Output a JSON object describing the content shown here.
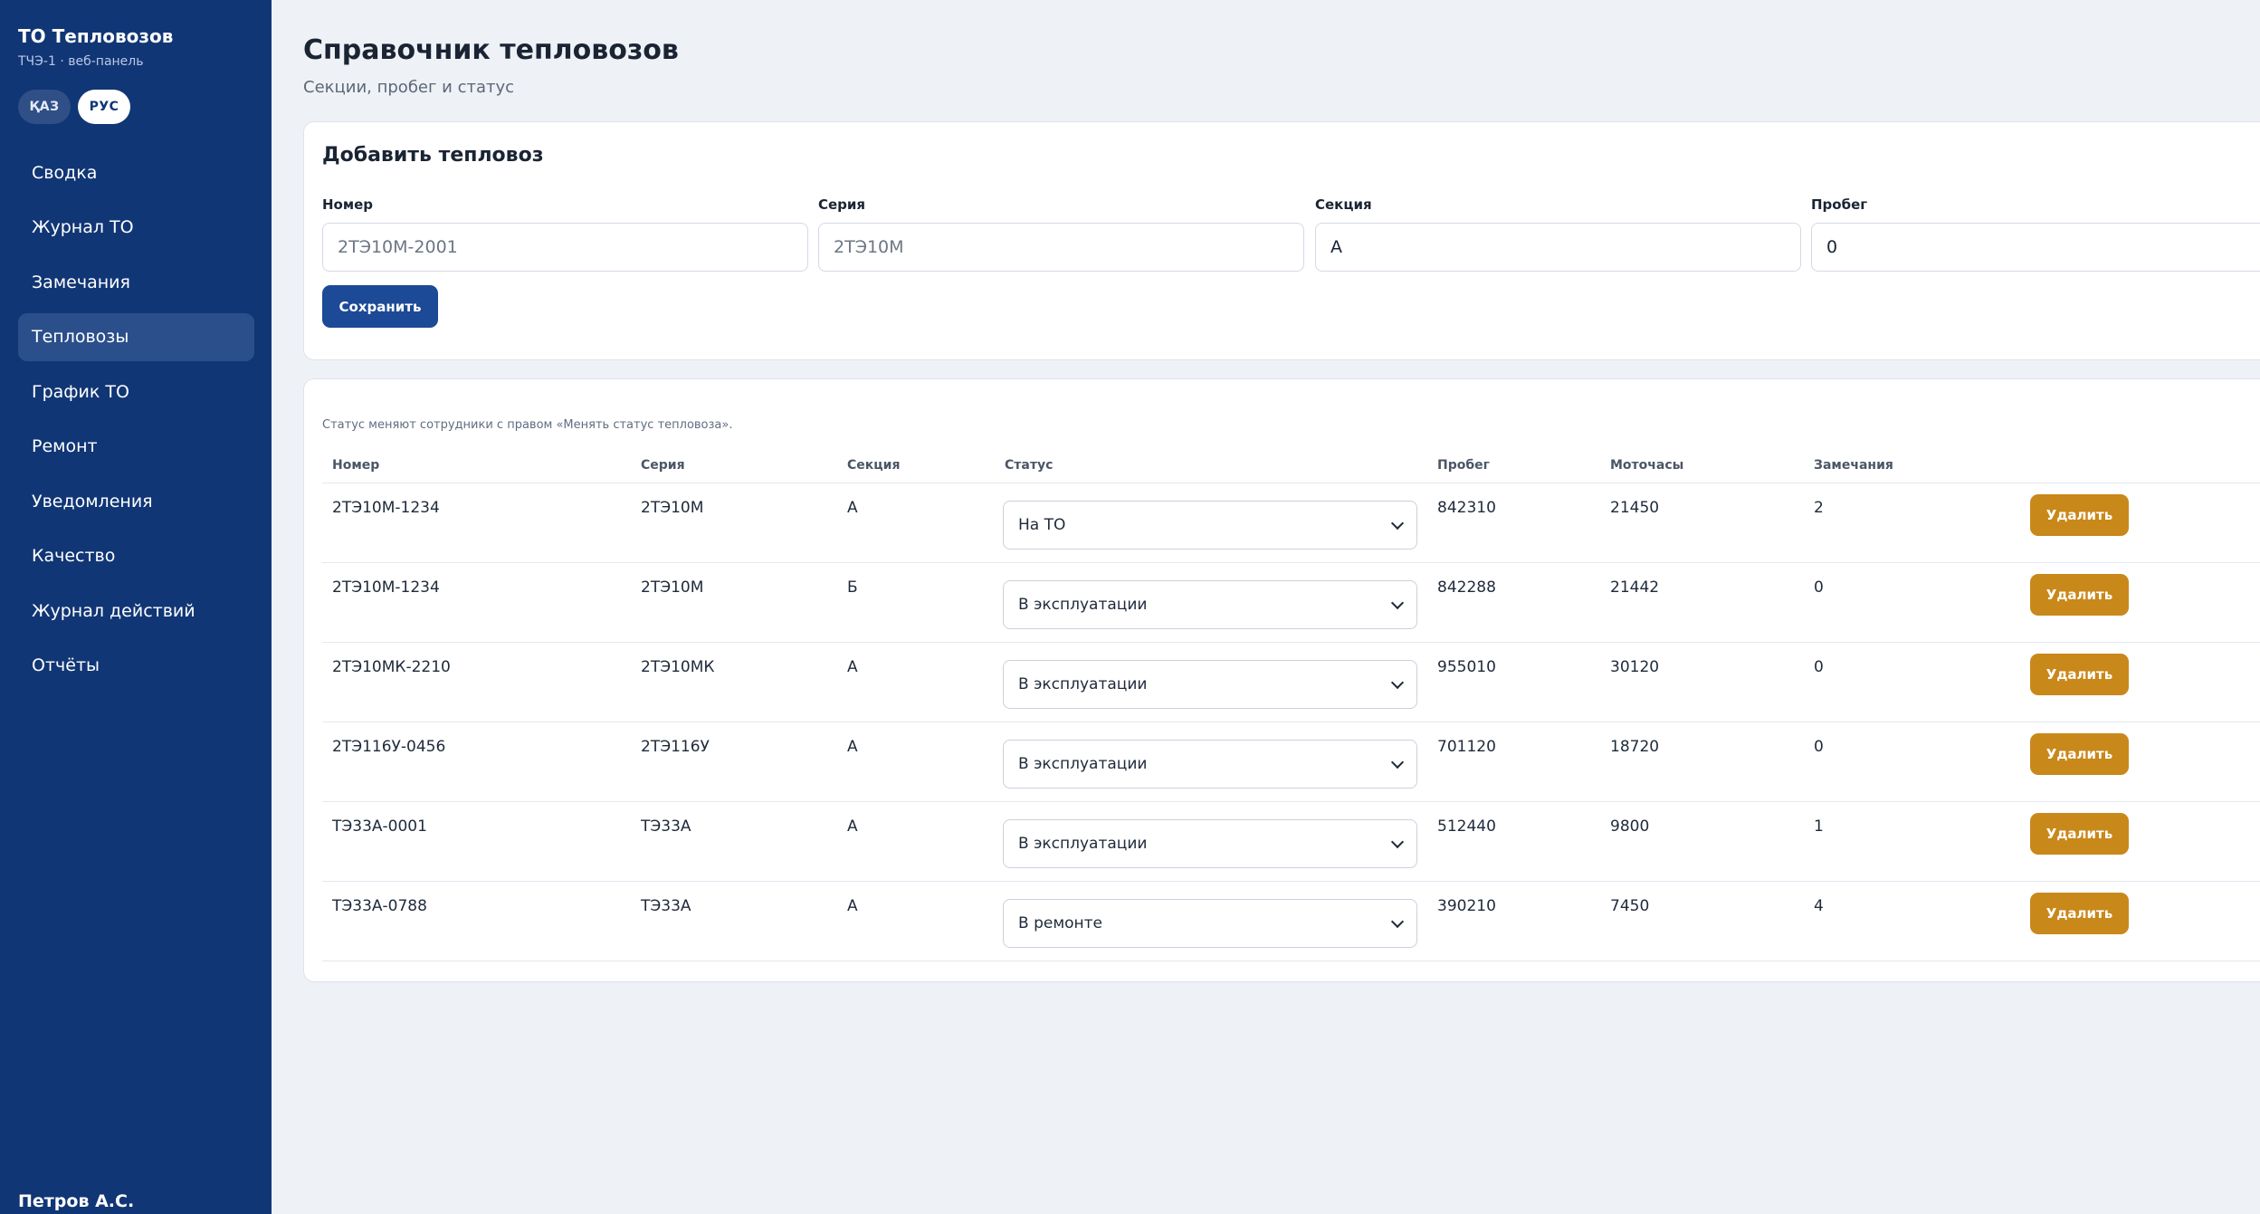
{
  "sidebar": {
    "brand_title": "ТО Тепловозов",
    "brand_sub": "ТЧЭ-1 · веб-панель",
    "lang": {
      "kaz": "ҚАЗ",
      "rus": "РУС",
      "selected": "РУС"
    },
    "items": [
      {
        "label": "Сводка"
      },
      {
        "label": "Журнал ТО"
      },
      {
        "label": "Замечания"
      },
      {
        "label": "Тепловозы",
        "active": true
      },
      {
        "label": "График ТО"
      },
      {
        "label": "Ремонт"
      },
      {
        "label": "Уведомления"
      },
      {
        "label": "Качество"
      },
      {
        "label": "Журнал действий"
      },
      {
        "label": "Отчёты"
      }
    ],
    "user_name": "Петров А.С."
  },
  "header": {
    "title": "Справочник тепловозов",
    "subtitle": "Секции, пробег и статус"
  },
  "add_form": {
    "title": "Добавить тепловоз",
    "fields": {
      "number": {
        "label": "Номер",
        "value": "",
        "placeholder": "2ТЭ10М-2001"
      },
      "series": {
        "label": "Серия",
        "value": "",
        "placeholder": "2ТЭ10М"
      },
      "section": {
        "label": "Секция",
        "value": "А",
        "placeholder": ""
      },
      "mileage": {
        "label": "Пробег",
        "value": "0",
        "placeholder": ""
      }
    },
    "save_label": "Сохранить"
  },
  "list": {
    "hint": "Статус меняют сотрудники с правом «Менять статус тепловоза».",
    "columns": {
      "number": "Номер",
      "series": "Серия",
      "section": "Секция",
      "status": "Статус",
      "mileage": "Пробег",
      "moto_hours": "Моточасы",
      "remarks": "Замечания"
    },
    "delete_label": "Удалить",
    "rows": [
      {
        "number": "2ТЭ10М-1234",
        "series": "2ТЭ10М",
        "section": "А",
        "status": "На ТО",
        "mileage": "842310",
        "moto_hours": "21450",
        "remarks": "2"
      },
      {
        "number": "2ТЭ10М-1234",
        "series": "2ТЭ10М",
        "section": "Б",
        "status": "В эксплуатации",
        "mileage": "842288",
        "moto_hours": "21442",
        "remarks": "0"
      },
      {
        "number": "2ТЭ10МК-2210",
        "series": "2ТЭ10МК",
        "section": "А",
        "status": "В эксплуатации",
        "mileage": "955010",
        "moto_hours": "30120",
        "remarks": "0"
      },
      {
        "number": "2ТЭ116У-0456",
        "series": "2ТЭ116У",
        "section": "А",
        "status": "В эксплуатации",
        "mileage": "701120",
        "moto_hours": "18720",
        "remarks": "0"
      },
      {
        "number": "ТЭ33А-0001",
        "series": "ТЭ33А",
        "section": "А",
        "status": "В эксплуатации",
        "mileage": "512440",
        "moto_hours": "9800",
        "remarks": "1"
      },
      {
        "number": "ТЭ33А-0788",
        "series": "ТЭ33А",
        "section": "А",
        "status": "В ремонте",
        "mileage": "390210",
        "moto_hours": "7450",
        "remarks": "4"
      }
    ]
  },
  "colors": {
    "sidebar_bg": "#113675",
    "sidebar_active": "#2b4f8b",
    "primary_button": "#1d4a96",
    "delete_button": "#c9881a",
    "page_bg": "#eef1f6"
  }
}
